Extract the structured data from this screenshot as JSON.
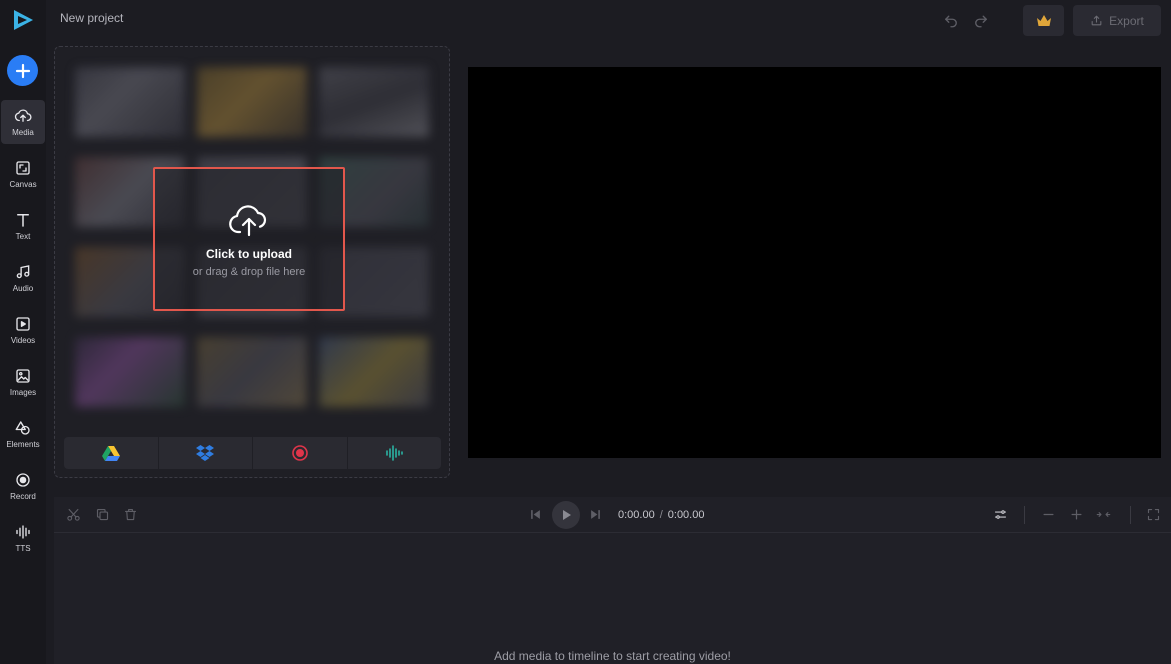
{
  "project": {
    "title": "New project"
  },
  "rail": {
    "items": [
      {
        "label": "Media",
        "icon": "upload-cloud-icon",
        "active": true
      },
      {
        "label": "Canvas",
        "icon": "canvas-icon"
      },
      {
        "label": "Text",
        "icon": "text-icon"
      },
      {
        "label": "Audio",
        "icon": "music-note-icon"
      },
      {
        "label": "Videos",
        "icon": "video-icon"
      },
      {
        "label": "Images",
        "icon": "image-icon"
      },
      {
        "label": "Elements",
        "icon": "shapes-icon"
      },
      {
        "label": "Record",
        "icon": "record-icon"
      },
      {
        "label": "TTS",
        "icon": "waveform-icon"
      }
    ]
  },
  "header": {
    "export_label": "Export"
  },
  "media": {
    "upload_title": "Click to upload",
    "upload_subtitle": "or drag & drop file here",
    "sources": [
      "google-drive-icon",
      "dropbox-icon",
      "record-screen-icon",
      "audio-wave-icon"
    ]
  },
  "timeline": {
    "current_time": "0:00.00",
    "separator": "/",
    "total_time": "0:00.00",
    "empty_message": "Add media to timeline to start creating video!"
  },
  "colors": {
    "accent": "#2a7df5",
    "upload_border": "#e2574c",
    "crown": "#e0a63a",
    "dropbox": "#2f7de1",
    "record": "#e0354a",
    "wave": "#2ab3a3"
  }
}
